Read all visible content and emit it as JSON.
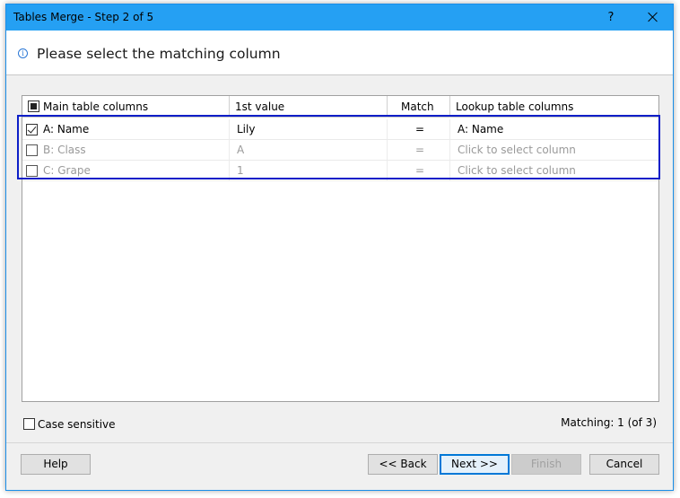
{
  "window": {
    "title": "Tables Merge - Step 2 of 5",
    "help_glyph": "?",
    "close_icon": "close-icon"
  },
  "header": {
    "info_glyph": "i",
    "heading": "Please select the matching column"
  },
  "grid": {
    "columns": [
      "Main table columns",
      "1st value",
      "Match",
      "Lookup table columns"
    ],
    "header_checkbox_state": "partial",
    "rows": [
      {
        "checked": true,
        "main": "A: Name",
        "value": "Lily",
        "match": "=",
        "lookup": "A: Name"
      },
      {
        "checked": false,
        "main": "B: Class",
        "value": "A",
        "match": "=",
        "lookup": "Click to select column"
      },
      {
        "checked": false,
        "main": "C: Grape",
        "value": "1",
        "match": "=",
        "lookup": "Click to select column"
      }
    ]
  },
  "options": {
    "case_sensitive_label": "Case sensitive",
    "case_sensitive_checked": false,
    "matching_text": "Matching: 1 (of 3)"
  },
  "buttons": {
    "help": "Help",
    "back": "<< Back",
    "next": "Next >>",
    "finish": "Finish",
    "cancel": "Cancel"
  },
  "colors": {
    "titlebar": "#25a0f3",
    "highlight_border": "#0b1ec8",
    "disabled_text": "#9a9a9a"
  }
}
